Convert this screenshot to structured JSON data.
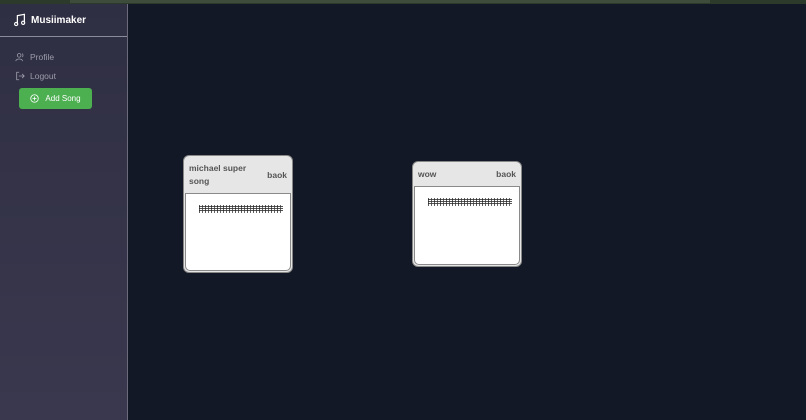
{
  "app": {
    "name": "Musiimaker",
    "brand_icon": "music-note-icon"
  },
  "sidebar": {
    "items": [
      {
        "label": "Profile",
        "icon": "user-icon"
      },
      {
        "label": "Logout",
        "icon": "logout-icon"
      }
    ],
    "add_button": {
      "label": "Add Song",
      "icon": "plus-circle-icon"
    }
  },
  "songs": [
    {
      "title": "michael super song",
      "action": "baok"
    },
    {
      "title": "wow",
      "action": "baok"
    }
  ],
  "colors": {
    "background": "#131826",
    "sidebar": "#34334a",
    "accent": "#4caf50",
    "card": "#e6e6e6"
  }
}
